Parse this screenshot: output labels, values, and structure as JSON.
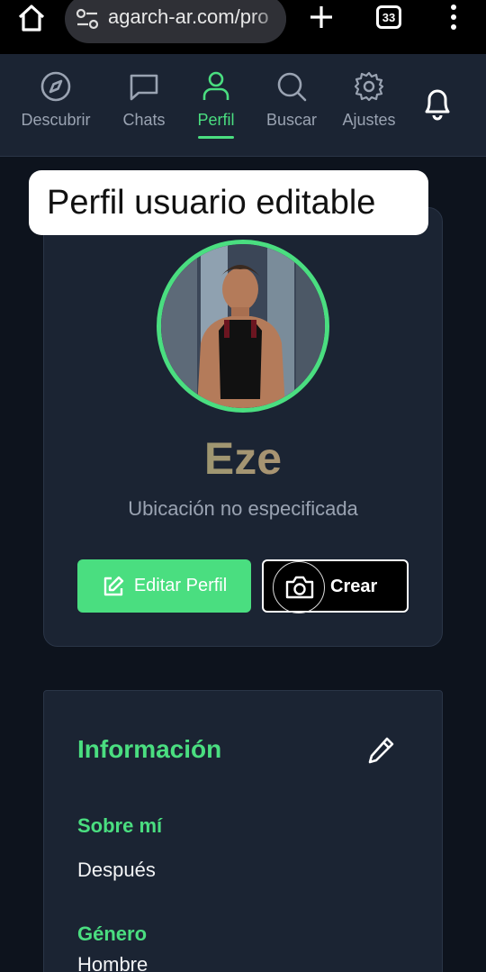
{
  "browser": {
    "url": "agarch-ar.com/pro",
    "tab_count": "33"
  },
  "nav": {
    "items": [
      {
        "label": "Descubrir",
        "icon": "compass-icon"
      },
      {
        "label": "Chats",
        "icon": "chat-bubble-icon"
      },
      {
        "label": "Perfil",
        "icon": "user-icon",
        "active": true
      },
      {
        "label": "Buscar",
        "icon": "search-icon"
      },
      {
        "label": "Ajustes",
        "icon": "gear-icon"
      }
    ],
    "bell_icon": "bell-icon"
  },
  "annotation": "Perfil usuario editable",
  "profile": {
    "name": "Eze",
    "location": "Ubicación no especificada",
    "edit_label": "Editar Perfil",
    "create_label": "Crear"
  },
  "info": {
    "title": "Información",
    "about_label": "Sobre mí",
    "about_value": "Después",
    "gender_label": "Género",
    "gender_value": "Hombre"
  },
  "colors": {
    "accent": "#4ade80",
    "background": "#0d131d",
    "card": "#1b2433"
  }
}
